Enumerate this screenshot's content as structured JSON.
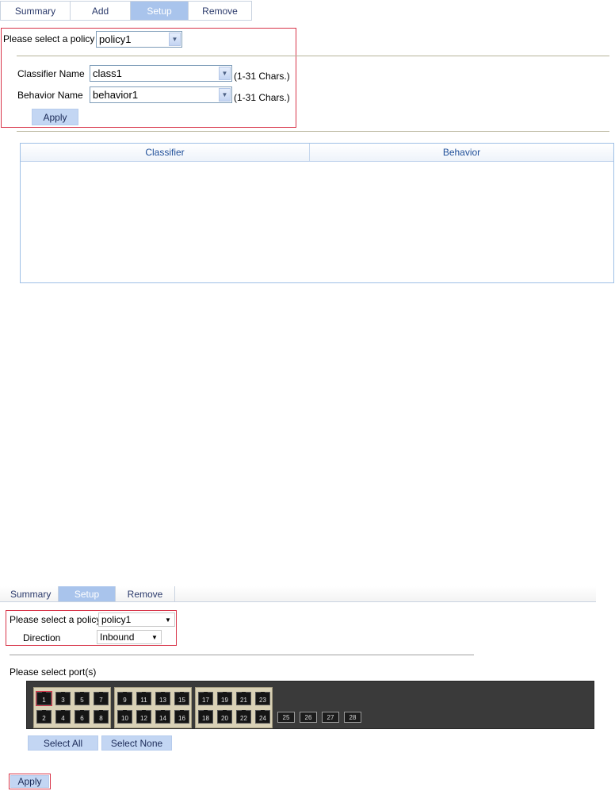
{
  "top": {
    "tabs": [
      "Summary",
      "Add",
      "Setup",
      "Remove"
    ],
    "policy_label": "Please select a policy",
    "policy_value": "policy1",
    "classifier_label": "Classifier Name",
    "classifier_value": "class1",
    "behavior_label": "Behavior Name",
    "behavior_value": "behavior1",
    "chars_hint": "(1-31 Chars.)",
    "apply_label": "Apply",
    "table_headers": [
      "Classifier",
      "Behavior"
    ]
  },
  "bottom": {
    "tabs": [
      "Summary",
      "Setup",
      "Remove"
    ],
    "policy_label": "Please select a policy",
    "policy_value": "policy1",
    "direction_label": "Direction",
    "direction_value": "Inbound",
    "ports_label": "Please select port(s)",
    "ports_top": [
      "1",
      "3",
      "5",
      "7",
      "9",
      "11",
      "13",
      "15",
      "17",
      "19",
      "21",
      "23"
    ],
    "ports_bottom": [
      "2",
      "4",
      "6",
      "8",
      "10",
      "12",
      "14",
      "16",
      "18",
      "20",
      "22",
      "24"
    ],
    "sfp_ports": [
      "25",
      "26",
      "27",
      "28"
    ],
    "selected_port": "1",
    "select_all_label": "Select All",
    "select_none_label": "Select None",
    "apply_label": "Apply"
  },
  "colors": {
    "active_tab": "#a9c4ec",
    "highlight": "#d8354a",
    "button": "#c3d6f3"
  }
}
